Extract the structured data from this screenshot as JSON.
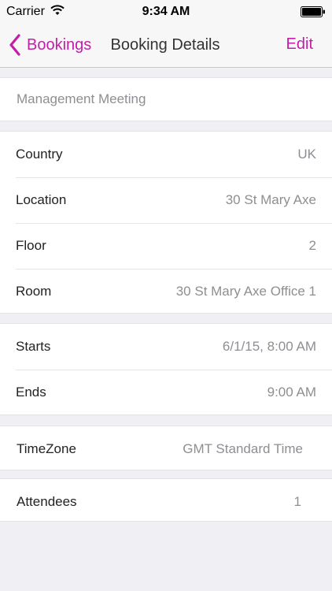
{
  "status_bar": {
    "carrier": "Carrier",
    "time": "9:34 AM"
  },
  "nav": {
    "back_label": "Bookings",
    "title": "Booking Details",
    "edit_label": "Edit",
    "accent_color": "#c21fa9"
  },
  "booking": {
    "title": "Management Meeting"
  },
  "location_section": [
    {
      "label": "Country",
      "value": "UK"
    },
    {
      "label": "Location",
      "value": "30 St Mary Axe"
    },
    {
      "label": "Floor",
      "value": "2"
    },
    {
      "label": "Room",
      "value": "30 St Mary Axe Office 1"
    }
  ],
  "time_section": [
    {
      "label": "Starts",
      "value": "6/1/15, 8:00 AM"
    },
    {
      "label": "Ends",
      "value": "9:00 AM"
    }
  ],
  "timezone": {
    "label": "TimeZone",
    "value": "GMT Standard Time"
  },
  "attendees": {
    "label": "Attendees",
    "value": "1"
  },
  "icons": [
    "wifi-icon",
    "battery-icon",
    "chevron-left-icon"
  ]
}
